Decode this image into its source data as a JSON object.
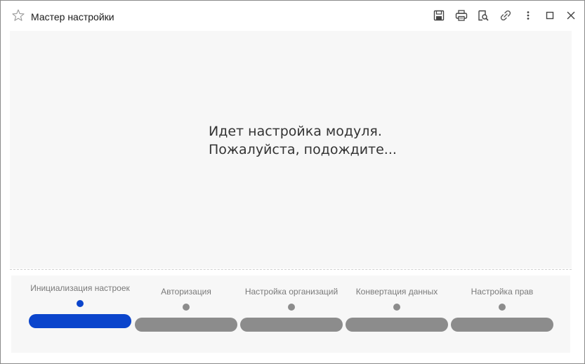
{
  "window": {
    "title": "Мастер настройки"
  },
  "toolbar": {
    "icons": [
      "star-icon",
      "save-icon",
      "print-icon",
      "preview-icon",
      "link-icon",
      "more-icon",
      "maximize-icon",
      "close-icon"
    ]
  },
  "main": {
    "message_line1": "Идет настройка модуля.",
    "message_line2": "Пожалуйста, подождите..."
  },
  "stepper": {
    "active_color": "#0b45cc",
    "inactive_color": "#8c8c8c",
    "steps": [
      {
        "label": "Инициализация настроек",
        "state": "active"
      },
      {
        "label": "Авторизация",
        "state": "pending"
      },
      {
        "label": "Настройка организаций",
        "state": "pending"
      },
      {
        "label": "Конвертация данных",
        "state": "pending"
      },
      {
        "label": "Настройка прав",
        "state": "pending"
      }
    ]
  }
}
